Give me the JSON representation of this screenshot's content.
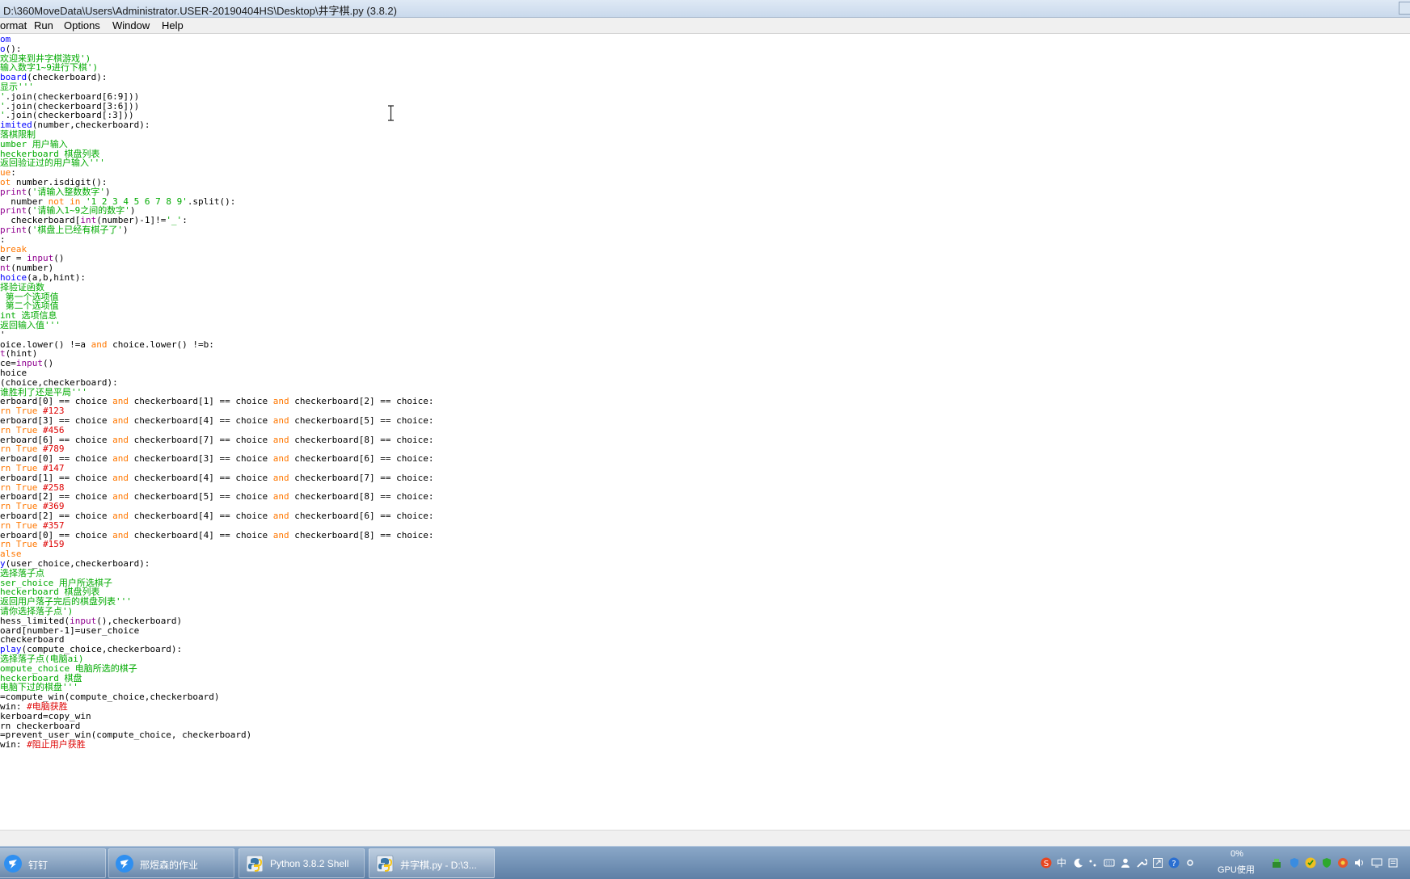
{
  "window": {
    "title": "D:\\360MoveData\\Users\\Administrator.USER-20190404HS\\Desktop\\井字棋.py (3.8.2)"
  },
  "menu": [
    "ormat",
    "Run",
    "Options",
    "Window",
    "Help"
  ],
  "code_lines": [
    [
      [
        "d",
        "om"
      ]
    ],
    [
      [
        "d",
        "o"
      ],
      [
        "p",
        "():"
      ]
    ],
    [
      [
        "s",
        "欢迎来到井字棋游戏')"
      ]
    ],
    [
      [
        "s",
        "输入数字1~9进行下棋')"
      ]
    ],
    [
      [
        "d",
        "board"
      ],
      [
        "p",
        "(checkerboard):"
      ]
    ],
    [
      [
        "s",
        "显示'''"
      ]
    ],
    [
      [
        "s",
        "'"
      ],
      [
        "p",
        ".join(checkerboard[6:9]))"
      ]
    ],
    [
      [
        "s",
        "'"
      ],
      [
        "p",
        ".join(checkerboard[3:6]))"
      ]
    ],
    [
      [
        "s",
        "'"
      ],
      [
        "p",
        ".join(checkerboard[:3]))"
      ]
    ],
    [
      [
        "d",
        "imited"
      ],
      [
        "p",
        "(number,checkerboard):"
      ]
    ],
    [
      [
        "s",
        "落棋限制"
      ]
    ],
    [
      [
        "s",
        "umber 用户输入"
      ]
    ],
    [
      [
        "s",
        "heckerboard 棋盘列表"
      ]
    ],
    [
      [
        "s",
        "返回验证过的用户输入'''"
      ]
    ],
    [
      [
        "k",
        "ue"
      ],
      [
        "p",
        ":"
      ]
    ],
    [
      [
        "k",
        "ot"
      ],
      [
        "p",
        " number.isdigit():"
      ]
    ],
    [
      [
        "b",
        "print"
      ],
      [
        "p",
        "("
      ],
      [
        "s",
        "'请输入整数数字'"
      ],
      [
        "p",
        ")"
      ]
    ],
    [
      [
        "p",
        "  number "
      ],
      [
        "k",
        "not in"
      ],
      [
        "s",
        " '1 2 3 4 5 6 7 8 9'"
      ],
      [
        "p",
        ".split():"
      ]
    ],
    [
      [
        "b",
        "print"
      ],
      [
        "p",
        "("
      ],
      [
        "s",
        "'请输入1~9之间的数字'"
      ],
      [
        "p",
        ")"
      ]
    ],
    [
      [
        "p",
        "  checkerboard["
      ],
      [
        "b",
        "int"
      ],
      [
        "p",
        "(number)-1]!="
      ],
      [
        "s",
        "'_'"
      ],
      [
        "p",
        ":"
      ]
    ],
    [
      [
        "b",
        "print"
      ],
      [
        "p",
        "("
      ],
      [
        "s",
        "'棋盘上已经有棋子了'"
      ],
      [
        "p",
        ")"
      ]
    ],
    [
      [
        "p",
        ":"
      ]
    ],
    [
      [
        "k",
        "break"
      ]
    ],
    [
      [
        "p",
        "er = "
      ],
      [
        "b",
        "input"
      ],
      [
        "p",
        "()"
      ]
    ],
    [
      [
        "b",
        "nt"
      ],
      [
        "p",
        "(number)"
      ]
    ],
    [
      [
        "d",
        "hoice"
      ],
      [
        "p",
        "(a,b,hint):"
      ]
    ],
    [
      [
        "s",
        "择验证函数"
      ]
    ],
    [
      [
        "s",
        " 第一个选项值"
      ]
    ],
    [
      [
        "s",
        " 第二个选项值"
      ]
    ],
    [
      [
        "s",
        "int 选项信息"
      ]
    ],
    [
      [
        "s",
        "返回输入值'''"
      ]
    ],
    [
      [
        "p",
        "'"
      ]
    ],
    [
      [
        "p",
        "oice.lower() !=a "
      ],
      [
        "k",
        "and"
      ],
      [
        "p",
        " choice.lower() !=b:"
      ]
    ],
    [
      [
        "b",
        "t"
      ],
      [
        "p",
        "(hint)"
      ]
    ],
    [
      [
        "p",
        "ce="
      ],
      [
        "b",
        "input"
      ],
      [
        "p",
        "()"
      ]
    ],
    [
      [
        "p",
        "hoice"
      ]
    ],
    [
      [
        "p",
        "(choice,checkerboard):"
      ]
    ],
    [
      [
        "s",
        "谁胜利了还是平局'''"
      ]
    ],
    [
      [
        "p",
        "erboard[0] == choice "
      ],
      [
        "k",
        "and"
      ],
      [
        "p",
        " checkerboard[1] == choice "
      ],
      [
        "k",
        "and"
      ],
      [
        "p",
        " checkerboard[2] == choice:"
      ]
    ],
    [
      [
        "k",
        "rn True"
      ],
      [
        "c",
        " #123"
      ]
    ],
    [
      [
        "p",
        "erboard[3] == choice "
      ],
      [
        "k",
        "and"
      ],
      [
        "p",
        " checkerboard[4] == choice "
      ],
      [
        "k",
        "and"
      ],
      [
        "p",
        " checkerboard[5] == choice:"
      ]
    ],
    [
      [
        "k",
        "rn True"
      ],
      [
        "c",
        " #456"
      ]
    ],
    [
      [
        "p",
        "erboard[6] == choice "
      ],
      [
        "k",
        "and"
      ],
      [
        "p",
        " checkerboard[7] == choice "
      ],
      [
        "k",
        "and"
      ],
      [
        "p",
        " checkerboard[8] == choice:"
      ]
    ],
    [
      [
        "k",
        "rn True"
      ],
      [
        "c",
        " #789"
      ]
    ],
    [
      [
        "p",
        "erboard[0] == choice "
      ],
      [
        "k",
        "and"
      ],
      [
        "p",
        " checkerboard[3] == choice "
      ],
      [
        "k",
        "and"
      ],
      [
        "p",
        " checkerboard[6] == choice:"
      ]
    ],
    [
      [
        "k",
        "rn True"
      ],
      [
        "c",
        " #147"
      ]
    ],
    [
      [
        "p",
        "erboard[1] == choice "
      ],
      [
        "k",
        "and"
      ],
      [
        "p",
        " checkerboard[4] == choice "
      ],
      [
        "k",
        "and"
      ],
      [
        "p",
        " checkerboard[7] == choice:"
      ]
    ],
    [
      [
        "k",
        "rn True"
      ],
      [
        "c",
        " #258"
      ]
    ],
    [
      [
        "p",
        "erboard[2] == choice "
      ],
      [
        "k",
        "and"
      ],
      [
        "p",
        " checkerboard[5] == choice "
      ],
      [
        "k",
        "and"
      ],
      [
        "p",
        " checkerboard[8] == choice:"
      ]
    ],
    [
      [
        "k",
        "rn True"
      ],
      [
        "c",
        " #369"
      ]
    ],
    [
      [
        "p",
        "erboard[2] == choice "
      ],
      [
        "k",
        "and"
      ],
      [
        "p",
        " checkerboard[4] == choice "
      ],
      [
        "k",
        "and"
      ],
      [
        "p",
        " checkerboard[6] == choice:"
      ]
    ],
    [
      [
        "k",
        "rn True"
      ],
      [
        "c",
        " #357"
      ]
    ],
    [
      [
        "p",
        "erboard[0] == choice "
      ],
      [
        "k",
        "and"
      ],
      [
        "p",
        " checkerboard[4] == choice "
      ],
      [
        "k",
        "and"
      ],
      [
        "p",
        " checkerboard[8] == choice:"
      ]
    ],
    [
      [
        "k",
        "rn True"
      ],
      [
        "c",
        " #159"
      ]
    ],
    [
      [
        "k",
        "alse"
      ]
    ],
    [
      [
        "d",
        "y"
      ],
      [
        "p",
        "(user_choice,checkerboard):"
      ]
    ],
    [
      [
        "s",
        "选择落子点"
      ]
    ],
    [
      [
        "s",
        "ser_choice 用户所选棋子"
      ]
    ],
    [
      [
        "s",
        "heckerboard 棋盘列表"
      ]
    ],
    [
      [
        "s",
        "返回用户落子完后的棋盘列表'''"
      ]
    ],
    [
      [
        "s",
        "请你选择落子点')"
      ]
    ],
    [
      [
        "p",
        "hess_limited("
      ],
      [
        "b",
        "input"
      ],
      [
        "p",
        "(),checkerboard)"
      ]
    ],
    [
      [
        "p",
        "oard[number-1]=user_choice"
      ]
    ],
    [
      [
        "p",
        "checkerboard"
      ]
    ],
    [
      [
        "d",
        "play"
      ],
      [
        "p",
        "(compute_choice,checkerboard):"
      ]
    ],
    [
      [
        "s",
        "选择落子点(电脑ai)"
      ]
    ],
    [
      [
        "s",
        "ompute_choice 电脑所选的棋子"
      ]
    ],
    [
      [
        "s",
        "heckerboard 棋盘"
      ]
    ],
    [
      [
        "s",
        "电脑下过的棋盘'''"
      ]
    ],
    [
      [
        "p",
        "=compute_win(compute_choice,checkerboard)"
      ]
    ],
    [
      [
        "p",
        "win: "
      ],
      [
        "c",
        "#电脑获胜"
      ]
    ],
    [
      [
        "p",
        "kerboard=copy_win"
      ]
    ],
    [
      [
        "p",
        "rn checkerboard"
      ]
    ],
    [
      [
        "p",
        "=prevent_user_win(compute_choice, checkerboard)"
      ]
    ],
    [
      [
        "p",
        "win: "
      ],
      [
        "c",
        "#阻止用户获胜"
      ]
    ]
  ],
  "taskbar": {
    "items": [
      {
        "label": "钉钉"
      },
      {
        "label": "邢煜森的作业"
      },
      {
        "label": "Python 3.8.2 Shell"
      },
      {
        "label": "井字棋.py - D:\\3..."
      }
    ]
  },
  "tray": {
    "ime_label": "中",
    "gpu_percent": "0%",
    "gpu_label": "GPU使用"
  },
  "colors": {
    "keyword": "#ff7700",
    "builtin": "#900090",
    "definition": "#0000ff",
    "string": "#00aa00",
    "comment": "#dd0000"
  }
}
